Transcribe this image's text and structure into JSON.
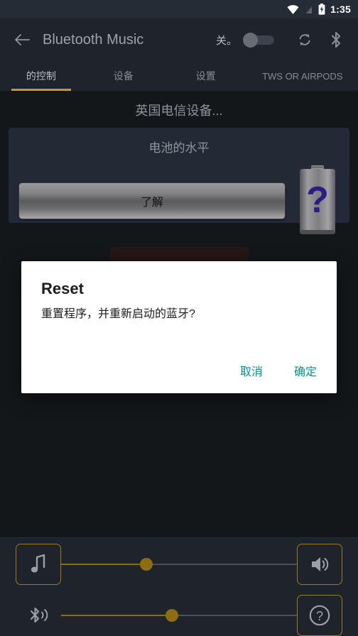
{
  "statusbar": {
    "time": "1:35",
    "icons": [
      "wifi-icon",
      "no-signal-icon",
      "battery-charging-icon"
    ]
  },
  "appbar": {
    "back_icon": "back-arrow-icon",
    "title": "Bluetooth Music",
    "switch_label": "关。",
    "switch_state": "off",
    "sync_icon": "sync-icon",
    "bluetooth_icon": "bluetooth-icon"
  },
  "tabs": {
    "active_index": 0,
    "items": [
      {
        "label": "的控制"
      },
      {
        "label": "设备"
      },
      {
        "label": "设置"
      },
      {
        "label": "TWS OR AIRPODS"
      }
    ]
  },
  "main": {
    "device_name": "英国电信设备...",
    "battery_card": {
      "title": "电池的水平",
      "button_label": "了解",
      "battery_indicator": "unknown",
      "battery_mark": "?"
    }
  },
  "dialog": {
    "title": "Reset",
    "message": "重置程序，并重新启动的蓝牙?",
    "cancel_label": "取消",
    "confirm_label": "确定",
    "accent_color": "#00978a"
  },
  "bottom_controls": {
    "media": {
      "icon": "music-note-icon",
      "slider_value": 36,
      "right_icon": "volume-up-icon"
    },
    "call": {
      "icon": "bluetooth-audio-icon",
      "slider_value": 47,
      "right_icon": "help-circle-icon"
    }
  },
  "theme": {
    "background": "#14171a",
    "surface": "#1e232c",
    "card": "#232a36",
    "accent": "#c8962a",
    "slider_fill": "#8d6d12",
    "text_primary": "#b8bec6",
    "text_secondary": "#868c94"
  }
}
